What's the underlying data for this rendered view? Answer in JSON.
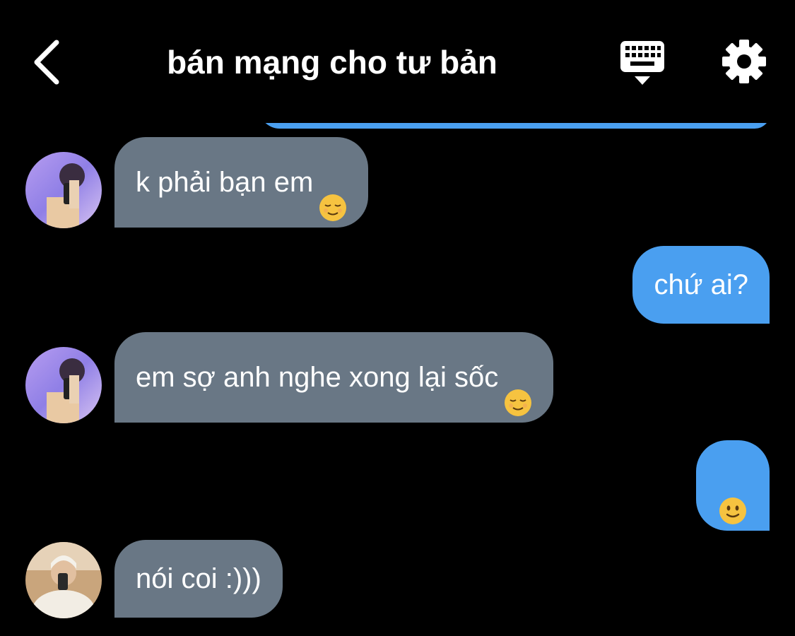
{
  "header": {
    "title": "bán mạng cho tư bản",
    "back_icon": "chevron-left-icon",
    "keyboard_icon": "keyboard-icon",
    "settings_icon": "gear-icon"
  },
  "colors": {
    "background": "#000000",
    "incoming_bubble": "#697785",
    "outgoing_bubble": "#4a9ff0",
    "text": "#ffffff"
  },
  "messages": [
    {
      "direction": "incoming",
      "text": "k phải bạn em",
      "emoji": "relieved-face-icon"
    },
    {
      "direction": "outgoing",
      "text": "chứ ai?"
    },
    {
      "direction": "incoming",
      "text": "em sợ anh nghe xong lại sốc",
      "emoji": "relieved-face-icon"
    },
    {
      "direction": "outgoing",
      "text": "",
      "emoji": "slightly-smiling-face-icon"
    },
    {
      "direction": "incoming",
      "text": "nói coi :)))"
    }
  ]
}
